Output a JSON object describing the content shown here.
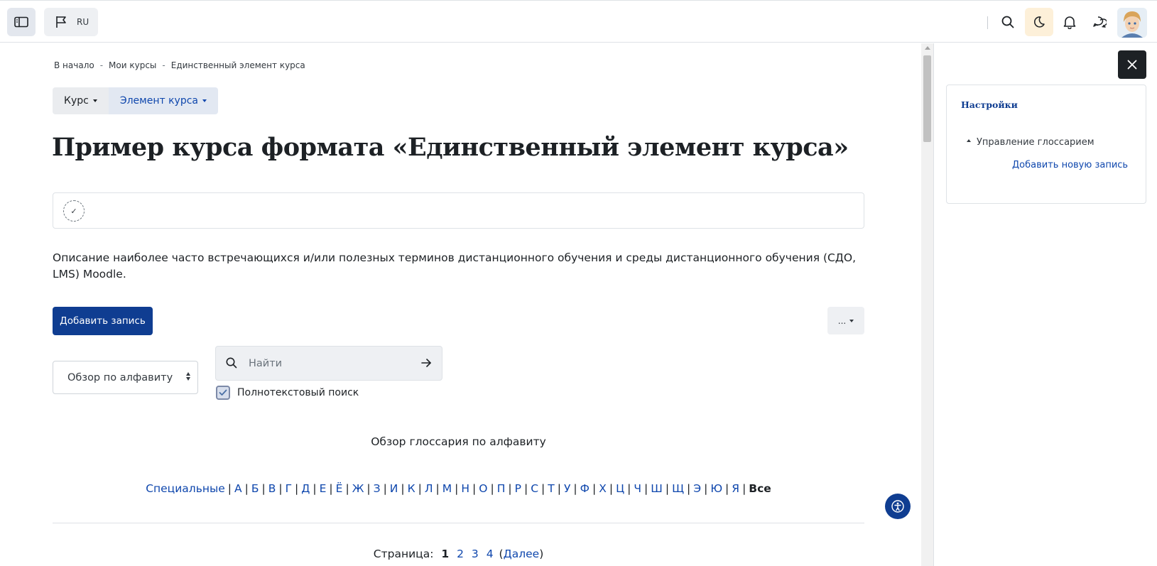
{
  "navbar": {
    "language": "RU",
    "colors": {
      "accent": "#0f3d91",
      "link": "#0f47ad",
      "darkmode_bg": "#fdf0d9"
    }
  },
  "breadcrumb": [
    "В начало",
    "Мои курсы",
    "Единственный элемент курса"
  ],
  "secondary_nav": {
    "course": "Курс",
    "activity": "Элемент курса"
  },
  "page": {
    "title": "Пример курса формата «Единственный элемент курса»",
    "description": "Описание наиболее часто встречающихся и/или полезных терминов дистанционного обучения и среды дистанционного обучения (СДО, LMS) Moodle.",
    "add_entry": "Добавить запись",
    "more": "...",
    "browse_mode": "Обзор по алфавиту",
    "search_placeholder": "Найти",
    "search_value": "",
    "fulltext_label": "Полнотекстовый поиск",
    "fulltext_checked": true,
    "browse_heading": "Обзор глоссария по алфавиту",
    "letters": [
      "Специальные",
      "А",
      "Б",
      "В",
      "Г",
      "Д",
      "Е",
      "Ё",
      "Ж",
      "З",
      "И",
      "К",
      "Л",
      "М",
      "Н",
      "О",
      "П",
      "Р",
      "С",
      "Т",
      "У",
      "Ф",
      "Х",
      "Ц",
      "Ч",
      "Ш",
      "Щ",
      "Э",
      "Ю",
      "Я"
    ],
    "letters_current": "Все",
    "pager": {
      "label": "Страница:",
      "current": "1",
      "pages": [
        "2",
        "3",
        "4"
      ],
      "open_paren": "(",
      "next": "Далее",
      "close_paren": ")"
    }
  },
  "drawer": {
    "settings_title": "Настройки",
    "node_label": "Управление глоссарием",
    "link_label": "Добавить новую запись"
  },
  "icons": {
    "sidebar_toggle": "sidebar-toggle-icon",
    "language": "flag-icon",
    "search": "search-icon",
    "darkmode": "moon-icon",
    "notifications": "bell-icon",
    "messages": "chat-icon",
    "close": "close-icon",
    "accessibility": "accessibility-icon"
  }
}
